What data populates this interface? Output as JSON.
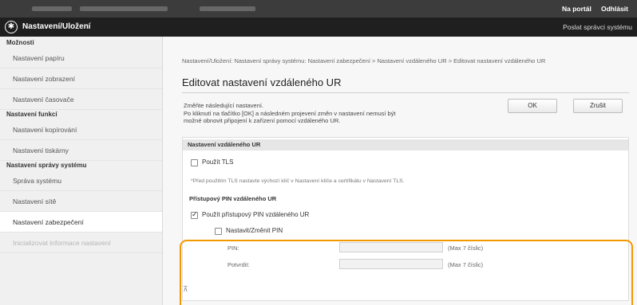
{
  "topbar": {
    "portal_link": "Na portál",
    "logout_link": "Odhlásit"
  },
  "titlebar": {
    "title": "Nastavení/Uložení",
    "mail_link": "Poslat správci systému"
  },
  "sidebar": {
    "groups": [
      {
        "heading": "Možnosti",
        "items": [
          "Nastavení papíru",
          "Nastavení zobrazení",
          "Nastavení časovače"
        ]
      },
      {
        "heading": "Nastavení funkcí",
        "items": [
          "Nastavení kopírování",
          "Nastavení tiskárny"
        ]
      },
      {
        "heading": "Nastavení správy systému",
        "items": [
          "Správa systému",
          "Nastavení sítě",
          "Nastavení zabezpečení",
          "Inicializovat informace nastavení"
        ]
      }
    ]
  },
  "main": {
    "breadcrumb": "Nastavení/Uložení: Nastavení správy systému: Nastavení zabezpečení > Nastavení vzdáleného UR > Editovat nastavení vzdáleného UR",
    "title": "Editovat nastavení vzdáleného UR",
    "description_line1": "Změňte následující nastavení.",
    "description_line2": "Po kliknutí na tlačítko [OK] a následném projevení změn v nastavení nemusí být",
    "description_line3": "možné obnovit připojení k zařízení pomocí vzdáleného UR.",
    "ok_label": "OK",
    "cancel_label": "Zrušit",
    "section_title": "Nastavení vzdáleného UR",
    "use_tls_label": "Použít TLS",
    "use_tls_checked": false,
    "tls_note": "*Před použitím TLS nastavte výchozí klíč v Nastavení klíče a certifikátu v Nastavení TLS.",
    "pin_section_title": "Přístupový PIN vzdáleného UR",
    "use_pin_label": "Použít přístupový PIN vzdáleného UR",
    "use_pin_checked": true,
    "set_pin_label": "Nastavit/Změnit PIN",
    "set_pin_checked": false,
    "pin_label": "PIN:",
    "pin_value": "",
    "pin_hint": "(Max 7 číslic)",
    "confirm_label": "Potvrdit:",
    "confirm_value": "",
    "confirm_hint": "(Max 7 číslic)",
    "scroll_marker": "⊼"
  },
  "colors": {
    "highlight": "#f39800",
    "titlebar": "#1f1f1f",
    "topbar": "#3c3c3c"
  }
}
